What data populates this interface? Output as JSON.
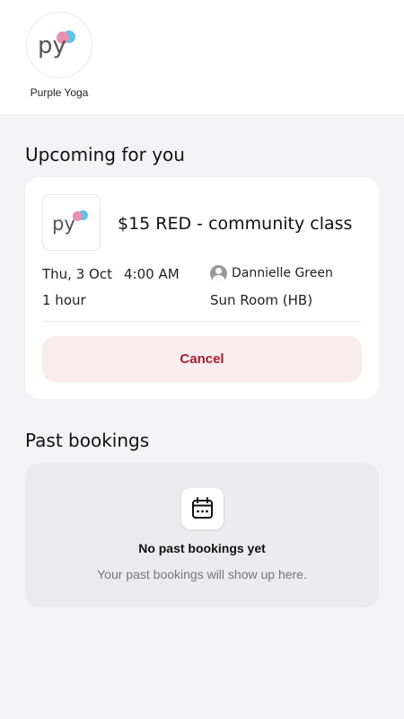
{
  "studio": {
    "logo_text": "py",
    "name": "Purple Yoga"
  },
  "upcoming": {
    "title": "Upcoming for you",
    "booking": {
      "class_name": "$15 RED - community class",
      "date": "Thu, 3 Oct",
      "time": "4:00 AM",
      "duration": "1 hour",
      "instructor": "Dannielle Green",
      "room": "Sun Room (HB)",
      "cancel_label": "Cancel"
    }
  },
  "past": {
    "title": "Past bookings",
    "empty_title": "No past bookings yet",
    "empty_subtitle": "Your past bookings will show up here."
  },
  "colors": {
    "logo_pink": "#e88fb4",
    "logo_blue": "#5bc4ea",
    "cancel_text": "#a3202e",
    "cancel_bg": "#f9eced"
  },
  "icons": {
    "logo": "purple-yoga-logo",
    "avatar": "user-avatar-icon",
    "calendar": "calendar-icon"
  }
}
